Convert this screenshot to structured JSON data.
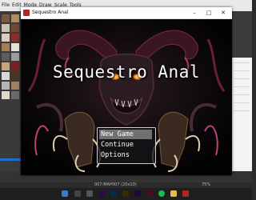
{
  "editor": {
    "menu": [
      "File",
      "Edit",
      "Mode",
      "Draw",
      "Scale",
      "Tools"
    ],
    "status": "007:MAP007 (20x10)",
    "zoom": "75%"
  },
  "game_window": {
    "title": "Sequestro Anal",
    "controls": {
      "minimize": "–",
      "maximize": "□",
      "close": "✕"
    }
  },
  "title_screen": {
    "game_title": "Sequestro Anal",
    "menu": [
      {
        "label": "New Game",
        "selected": true
      },
      {
        "label": "Continue",
        "selected": false
      },
      {
        "label": "Options",
        "selected": false
      }
    ]
  },
  "taskbar": {
    "icons": [
      "start-icon",
      "search-icon",
      "taskview-icon",
      "premiere-icon",
      "photoshop-icon",
      "illustrator-icon",
      "aftereffects-icon",
      "animate-icon",
      "spotify-icon",
      "folder-icon",
      "game-icon"
    ],
    "colors": {
      "bar": "#1f1f1f"
    }
  }
}
